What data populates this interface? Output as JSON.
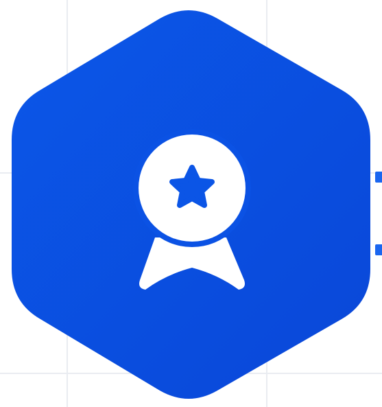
{
  "badge": {
    "icon": "award-ribbon-star-icon",
    "shape": "hexagon",
    "gradient_start": "#0b57e8",
    "gradient_end": "#0a47d8",
    "icon_color": "#ffffff"
  },
  "canvas": {
    "background": "#ffffff",
    "grid_color": "#e9ecf1",
    "side_accent_color": "#1a66f0"
  }
}
